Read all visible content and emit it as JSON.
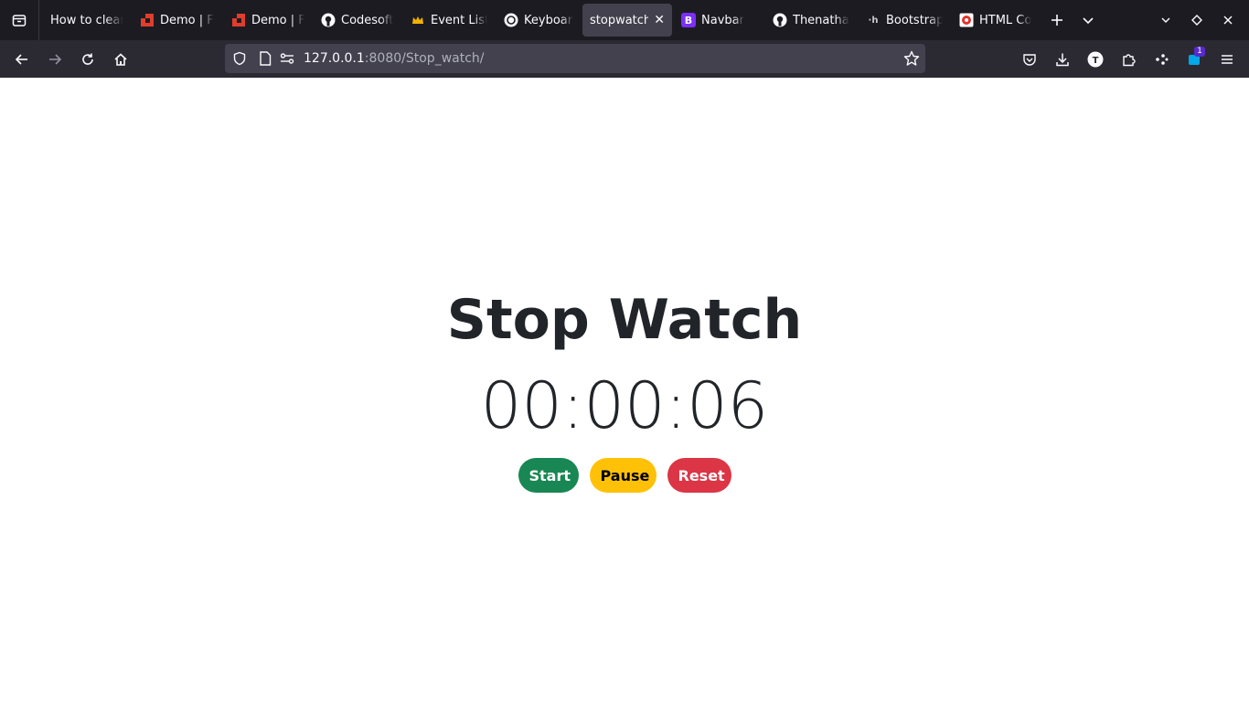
{
  "browser": {
    "tabs": [
      {
        "label": "How to clean",
        "favicon": "none",
        "active": false
      },
      {
        "label": "Demo | F",
        "favicon": "red-blocks-icon",
        "active": false
      },
      {
        "label": "Demo | F",
        "favicon": "red-blocks-icon",
        "active": false
      },
      {
        "label": "Codesoft",
        "favicon": "github-icon",
        "active": false
      },
      {
        "label": "Event List",
        "favicon": "crown-icon",
        "active": false
      },
      {
        "label": "Keyboard",
        "favicon": "openai-icon",
        "active": false
      },
      {
        "label": "stopwatch",
        "favicon": "none",
        "active": true
      },
      {
        "label": "Navbar",
        "favicon": "bootstrap-icon",
        "active": false
      },
      {
        "label": "Thenatha",
        "favicon": "github-icon",
        "active": false
      },
      {
        "label": "Bootstrap",
        "favicon": "hashnode-icon",
        "active": false
      },
      {
        "label": "HTML Co",
        "favicon": "red-circle-icon",
        "active": false
      }
    ],
    "url": {
      "host": "127.0.0.1",
      "rest": ":8080/Stop_watch/"
    },
    "extension_badge": "1"
  },
  "page": {
    "title": "Stop Watch",
    "time": "00:00:06",
    "buttons": {
      "start": "Start",
      "pause": "Pause",
      "reset": "Reset"
    }
  },
  "colors": {
    "start": "#198754",
    "pause": "#ffc107",
    "reset": "#dc3545",
    "text": "#212529"
  }
}
